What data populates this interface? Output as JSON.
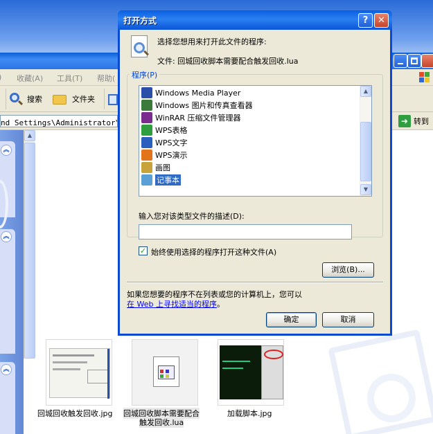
{
  "background": {
    "menu": [
      "收藏(A)",
      "工具(T)",
      "帮助("
    ],
    "toolbar": {
      "search": "搜索",
      "folders": "文件夹"
    },
    "address_path": "nd Settings\\Administrator\\桌面",
    "go_button": "转到",
    "files": [
      {
        "name": "回城回收触发回收.jpg"
      },
      {
        "name_line1": "回城回收脚本需要配合",
        "name_line2": "触发回收.lua"
      },
      {
        "name": "加载脚本.jpg"
      }
    ]
  },
  "dialog": {
    "title": "打开方式",
    "help_glyph": "?",
    "close_glyph": "✕",
    "prompt": "选择您想用来打开此文件的程序:",
    "file_label": "文件: 回城回收脚本需要配合触发回收.lua",
    "programs_label": "程序(P)",
    "programs": [
      {
        "label": "Windows Media Player",
        "icon": "media-player-icon",
        "color": "#2a4fa8"
      },
      {
        "label": "Windows 图片和传真查看器",
        "icon": "picture-viewer-icon",
        "color": "#3a7a3a"
      },
      {
        "label": "WinRAR 压缩文件管理器",
        "icon": "winrar-icon",
        "color": "#7a2d8f"
      },
      {
        "label": "WPS表格",
        "icon": "wps-spreadsheet-icon",
        "color": "#2e9e3e"
      },
      {
        "label": "WPS文字",
        "icon": "wps-writer-icon",
        "color": "#2a5fbd"
      },
      {
        "label": "WPS演示",
        "icon": "wps-presentation-icon",
        "color": "#e2741b"
      },
      {
        "label": "画图",
        "icon": "paint-icon",
        "color": "#c8a23a"
      },
      {
        "label": "记事本",
        "icon": "notepad-icon",
        "color": "#5aa0d6",
        "selected": true
      }
    ],
    "description_label": "输入您对该类型文件的描述(D):",
    "description_value": "",
    "always_use_label": "始终使用选择的程序打开这种文件(A)",
    "always_use_checked": true,
    "browse_button": "浏览(B)...",
    "footer_text": "如果您想要的程序不在列表或您的计算机上，您可以",
    "footer_link": "在 Web 上寻找适当的程序",
    "footer_period": "。",
    "ok_button": "确定",
    "cancel_button": "取消"
  }
}
